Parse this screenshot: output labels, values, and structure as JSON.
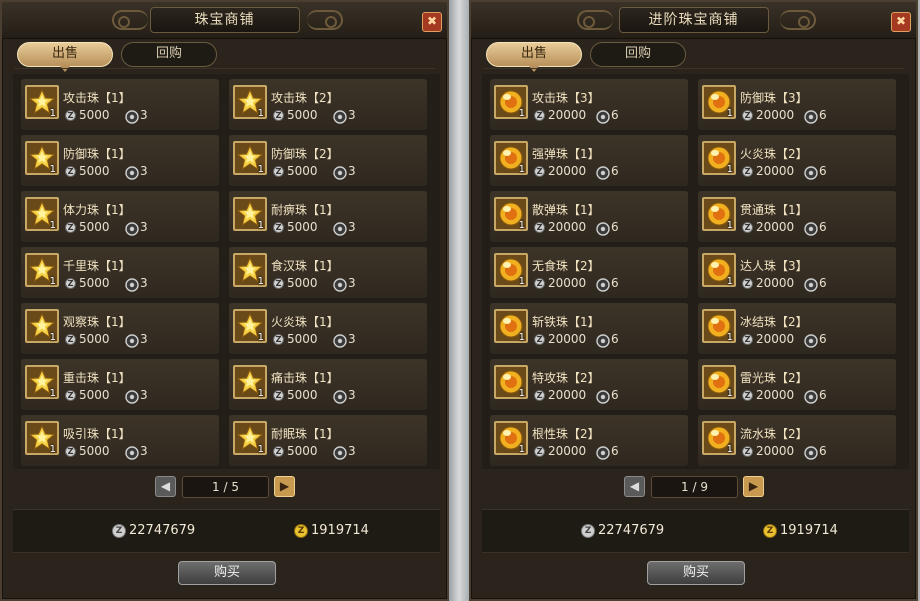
{
  "colors": {
    "panel_bg": "#2a241c",
    "item_bg": "#3a3126",
    "tab_active": "#d9b57c",
    "accent_gold": "#e8c030"
  },
  "panels": [
    {
      "title": "珠宝商铺",
      "tabs": [
        {
          "label": "出售",
          "active": true
        },
        {
          "label": "回购",
          "active": false
        }
      ],
      "icon_style": "star-jewel-icon",
      "items": [
        {
          "name": "攻击珠【1】",
          "count": "1",
          "price": "5000",
          "gems": "3"
        },
        {
          "name": "攻击珠【2】",
          "count": "1",
          "price": "5000",
          "gems": "3"
        },
        {
          "name": "防御珠【1】",
          "count": "1",
          "price": "5000",
          "gems": "3"
        },
        {
          "name": "防御珠【2】",
          "count": "1",
          "price": "5000",
          "gems": "3"
        },
        {
          "name": "体力珠【1】",
          "count": "1",
          "price": "5000",
          "gems": "3"
        },
        {
          "name": "耐痹珠【1】",
          "count": "1",
          "price": "5000",
          "gems": "3"
        },
        {
          "name": "千里珠【1】",
          "count": "1",
          "price": "5000",
          "gems": "3"
        },
        {
          "name": "食汉珠【1】",
          "count": "1",
          "price": "5000",
          "gems": "3"
        },
        {
          "name": "观察珠【1】",
          "count": "1",
          "price": "5000",
          "gems": "3"
        },
        {
          "name": "火炎珠【1】",
          "count": "1",
          "price": "5000",
          "gems": "3"
        },
        {
          "name": "重击珠【1】",
          "count": "1",
          "price": "5000",
          "gems": "3"
        },
        {
          "name": "痛击珠【1】",
          "count": "1",
          "price": "5000",
          "gems": "3"
        },
        {
          "name": "吸引珠【1】",
          "count": "1",
          "price": "5000",
          "gems": "3"
        },
        {
          "name": "耐眠珠【1】",
          "count": "1",
          "price": "5000",
          "gems": "3"
        }
      ],
      "page": "1 / 5",
      "silver": "22747679",
      "gold": "1919714",
      "buy_label": "购买"
    },
    {
      "title": "进阶珠宝商铺",
      "tabs": [
        {
          "label": "出售",
          "active": true
        },
        {
          "label": "回购",
          "active": false
        }
      ],
      "icon_style": "orb-jewel-icon",
      "items": [
        {
          "name": "攻击珠【3】",
          "count": "1",
          "price": "20000",
          "gems": "6"
        },
        {
          "name": "防御珠【3】",
          "count": "1",
          "price": "20000",
          "gems": "6"
        },
        {
          "name": "强弹珠【1】",
          "count": "1",
          "price": "20000",
          "gems": "6"
        },
        {
          "name": "火炎珠【2】",
          "count": "1",
          "price": "20000",
          "gems": "6"
        },
        {
          "name": "散弹珠【1】",
          "count": "1",
          "price": "20000",
          "gems": "6"
        },
        {
          "name": "贯通珠【1】",
          "count": "1",
          "price": "20000",
          "gems": "6"
        },
        {
          "name": "无食珠【2】",
          "count": "1",
          "price": "20000",
          "gems": "6"
        },
        {
          "name": "达人珠【3】",
          "count": "1",
          "price": "20000",
          "gems": "6"
        },
        {
          "name": "斩铁珠【1】",
          "count": "1",
          "price": "20000",
          "gems": "6"
        },
        {
          "name": "冰结珠【2】",
          "count": "1",
          "price": "20000",
          "gems": "6"
        },
        {
          "name": "特攻珠【2】",
          "count": "1",
          "price": "20000",
          "gems": "6"
        },
        {
          "name": "雷光珠【2】",
          "count": "1",
          "price": "20000",
          "gems": "6"
        },
        {
          "name": "根性珠【2】",
          "count": "1",
          "price": "20000",
          "gems": "6"
        },
        {
          "name": "流水珠【2】",
          "count": "1",
          "price": "20000",
          "gems": "6"
        }
      ],
      "page": "1 / 9",
      "silver": "22747679",
      "gold": "1919714",
      "buy_label": "购买"
    }
  ]
}
